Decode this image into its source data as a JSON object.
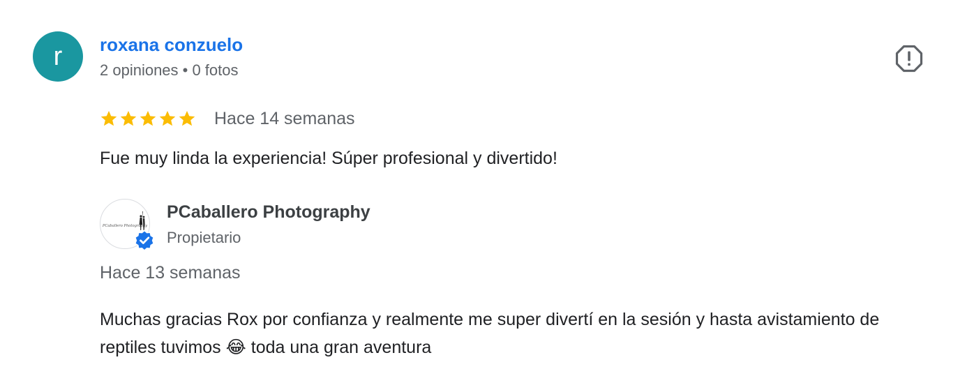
{
  "review": {
    "reviewer": {
      "initial": "r",
      "name": "roxana conzuelo",
      "meta": "2 opiniones • 0 fotos",
      "avatar_color": "#1a97a0"
    },
    "rating": 5,
    "rating_max": 5,
    "date": "Hace 14 semanas",
    "text": "Fue muy linda la experiencia! Súper profesional y divertido!",
    "report_icon": "report-flag-icon"
  },
  "owner_reply": {
    "logo_text": "PCaballero Photography",
    "name": "PCaballero Photography",
    "role": "Propietario",
    "verified_icon": "verified-check-icon",
    "date": "Hace 13 semanas",
    "text": "Muchas gracias Rox por confianza y realmente me super divertí en la sesión y hasta avistamiento de reptiles tuvimos 😂 toda una gran aventura"
  },
  "colors": {
    "star": "#fbbc04",
    "link": "#1a73e8",
    "verified": "#1a73e8",
    "secondary_text": "#5f6368"
  }
}
